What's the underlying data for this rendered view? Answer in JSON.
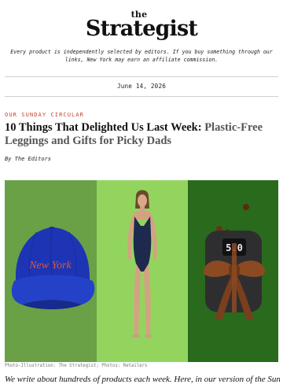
{
  "brand": {
    "the": "the",
    "name": "Strategist"
  },
  "disclaimer": "Every product is independently selected by editors. If you buy something through our links, New York may earn an affiliate commission.",
  "date": "June 14, 2026",
  "article": {
    "kicker": "Our Sunday Circular",
    "headline_main": "10 Things That Delighted Us Last Week:",
    "headline_dek": "Plastic-Free Leggings and Gifts for Picky Dads",
    "byline": "By The Editors",
    "caption": "Photo-Illustration: The Strategist; Photos: Retailers",
    "intro": "We write about hundreds of products each week. Here, in our version of the Sunday"
  },
  "hero": {
    "panels": [
      {
        "product": "cap",
        "background": "#6aa147",
        "embroidery": "New York"
      },
      {
        "product": "swimsuit",
        "background": "#93d45f"
      },
      {
        "product": "air-fryer",
        "background": "#2a6a1c",
        "display": "5.0"
      }
    ]
  },
  "colors": {
    "kicker": "#c9412a",
    "dek": "#555555",
    "divider": "#cfcfcf"
  }
}
